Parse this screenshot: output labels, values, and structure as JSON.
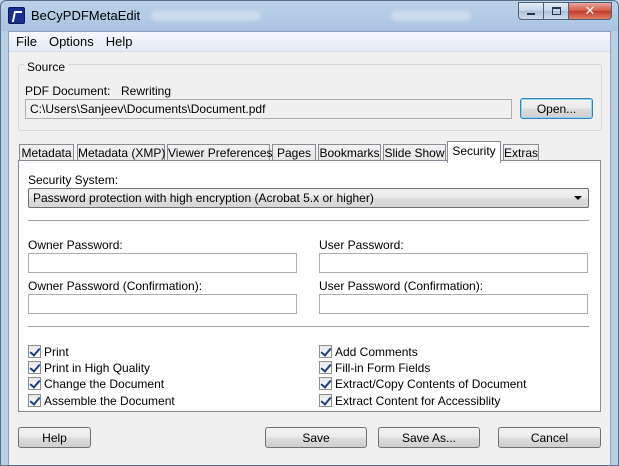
{
  "window": {
    "title": "BeCyPDFMetaEdit",
    "caption_close": "✕"
  },
  "menu": [
    "File",
    "Options",
    "Help"
  ],
  "source": {
    "group_title": "Source",
    "pdf_document_label": "PDF Document:",
    "pdf_document_mode": "Rewriting",
    "path": "C:\\Users\\Sanjeev\\Documents\\Document.pdf",
    "open_label": "Open..."
  },
  "tabs": [
    {
      "label": "Metadata"
    },
    {
      "label": "Metadata (XMP)"
    },
    {
      "label": "Viewer Preferences"
    },
    {
      "label": "Pages"
    },
    {
      "label": "Bookmarks"
    },
    {
      "label": "Slide Show"
    },
    {
      "label": "Security"
    },
    {
      "label": "Extras"
    }
  ],
  "active_tab": "Security",
  "security": {
    "system_label": "Security System:",
    "system_value": "Password protection with high encryption (Acrobat 5.x or higher)",
    "owner_password_label": "Owner Password:",
    "owner_password_value": "",
    "user_password_label": "User Password:",
    "user_password_value": "",
    "owner_confirm_label": "Owner Password (Confirmation):",
    "owner_confirm_value": "",
    "user_confirm_label": "User Password (Confirmation):",
    "user_confirm_value": "",
    "permissions_left": [
      {
        "label": "Print",
        "checked": true
      },
      {
        "label": "Print in High Quality",
        "checked": true
      },
      {
        "label": "Change the Document",
        "checked": true
      },
      {
        "label": "Assemble the Document",
        "checked": true
      }
    ],
    "permissions_right": [
      {
        "label": "Add Comments",
        "checked": true
      },
      {
        "label": "Fill-in Form Fields",
        "checked": true
      },
      {
        "label": "Extract/Copy Contents of Document",
        "checked": true
      },
      {
        "label": "Extract Content for Accessiblity",
        "checked": true
      }
    ]
  },
  "buttons": {
    "help": "Help",
    "save": "Save",
    "save_as": "Save As...",
    "cancel": "Cancel"
  },
  "colors": {
    "titlebar": "#bcd2ea",
    "client_background": "#f0f0f0",
    "close_button": "#c0392b",
    "checkmark": "#1e3f88"
  }
}
